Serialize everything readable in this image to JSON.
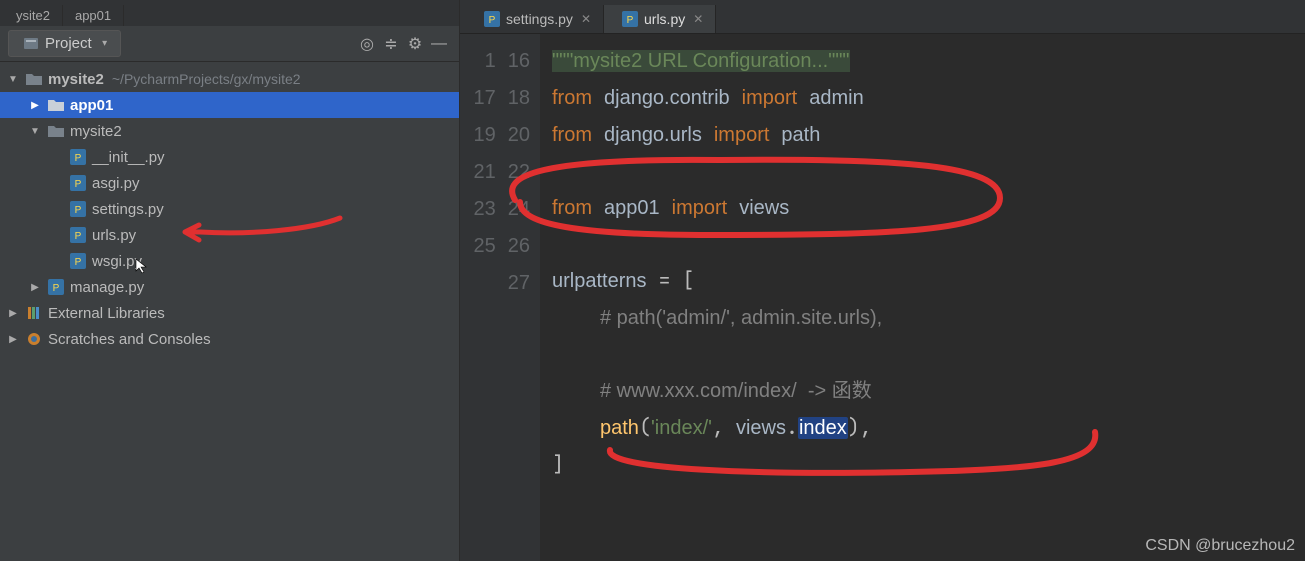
{
  "topTabs": [
    "ysite2",
    "app01"
  ],
  "panel": {
    "projectLabel": "Project"
  },
  "tree": {
    "root": {
      "name": "mysite2",
      "path": "~/PycharmProjects/gx/mysite2",
      "children": [
        {
          "name": "app01"
        },
        {
          "name": "mysite2",
          "children": [
            "__init__.py",
            "asgi.py",
            "settings.py",
            "urls.py",
            "wsgi.py"
          ]
        },
        {
          "name": "manage.py"
        }
      ]
    },
    "externalLibraries": "External Libraries",
    "scratches": "Scratches and Consoles"
  },
  "editor": {
    "tabs": [
      {
        "label": "settings.py",
        "active": false
      },
      {
        "label": "urls.py",
        "active": true
      }
    ],
    "lineNumbers": [
      "1",
      "16",
      "17",
      "18",
      "19",
      "20",
      "21",
      "22",
      "23",
      "24",
      "25",
      "26",
      "27"
    ],
    "kw": {
      "from": "from",
      "import": "import"
    },
    "code": {
      "docstring": "\"\"\"mysite2 URL Configuration...\"\"\"",
      "import1_mod": "django.contrib",
      "import1_name": "admin",
      "import2_mod": "django.urls",
      "import2_name": "path",
      "import3_mod": "app01",
      "import3_name": "views",
      "varname": "urlpatterns",
      "comment1": "# path('admin/', admin.site.urls),",
      "comment2": "# www.xxx.com/index/  -> 函数",
      "call": "path",
      "route": "'index/'",
      "view_mod": "views",
      "view_fn": "index"
    }
  },
  "watermark": "CSDN @brucezhou2"
}
